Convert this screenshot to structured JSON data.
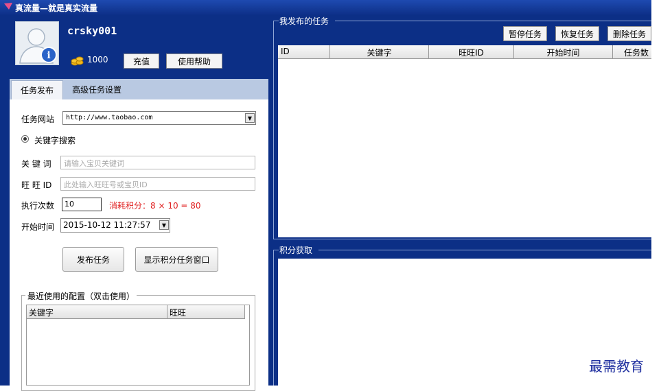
{
  "window": {
    "title": "真流量—就是真实流量"
  },
  "profile": {
    "username": "crsky001",
    "points": "1000",
    "recharge_label": "充值",
    "help_label": "使用帮助"
  },
  "tabs": [
    {
      "label": "任务发布"
    },
    {
      "label": "高级任务设置"
    }
  ],
  "form": {
    "site_label": "任务网站",
    "site_value": "http://www.taobao.com",
    "search_mode_label": "关键字搜索",
    "keyword_label": "关 键 词",
    "keyword_placeholder": "请输入宝贝关键词",
    "wangwang_label": "旺 旺 ID",
    "wangwang_placeholder": "此处输入旺旺号或宝贝ID",
    "count_label": "执行次数",
    "count_value": "10",
    "cost_text": "消耗积分：8 × 10 = 80",
    "start_label": "开始时间",
    "start_value": "2015-10-12 11:27:57",
    "publish_label": "发布任务",
    "show_points_label": "显示积分任务窗口"
  },
  "recent": {
    "legend": "最近使用的配置（双击使用）",
    "columns": [
      "关键字",
      "旺旺"
    ]
  },
  "tasks": {
    "legend": "我发布的任务",
    "pause_label": "暂停任务",
    "resume_label": "恢复任务",
    "delete_label": "删除任务",
    "columns": [
      "ID",
      "关键字",
      "旺旺ID",
      "开始时间",
      "任务数"
    ]
  },
  "points_panel": {
    "legend": "积分获取"
  },
  "watermark": "最需教育",
  "colors": {
    "window_bg": "#0c2f86",
    "cost_red": "#e02020"
  }
}
